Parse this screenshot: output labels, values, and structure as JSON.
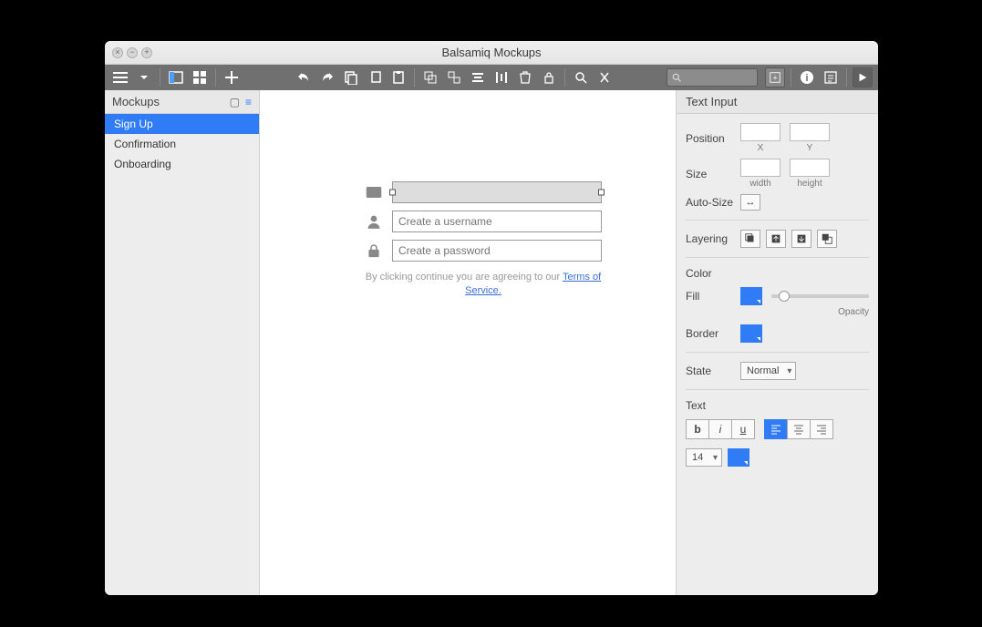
{
  "window": {
    "title": "Balsamiq Mockups"
  },
  "sidebar": {
    "title": "Mockups",
    "items": [
      {
        "label": "Sign Up",
        "active": true
      },
      {
        "label": "Confirmation",
        "active": false
      },
      {
        "label": "Onboarding",
        "active": false
      }
    ]
  },
  "canvas": {
    "username_placeholder": "Create a username",
    "password_placeholder": "Create a password",
    "terms_prefix": "By clicking continue you are agreeing to our ",
    "terms_link": "Terms of Service."
  },
  "inspector": {
    "title": "Text Input",
    "position_label": "Position",
    "x_label": "X",
    "y_label": "Y",
    "size_label": "Size",
    "width_label": "width",
    "height_label": "height",
    "autosize_label": "Auto-Size",
    "layering_label": "Layering",
    "color_label": "Color",
    "fill_label": "Fill",
    "border_label": "Border",
    "opacity_label": "Opacity",
    "state_label": "State",
    "state_value": "Normal",
    "text_label": "Text",
    "bold": "b",
    "italic": "i",
    "underline": "u",
    "font_size": "14",
    "fill_color": "#2f7cf6",
    "border_color": "#2f7cf6"
  }
}
